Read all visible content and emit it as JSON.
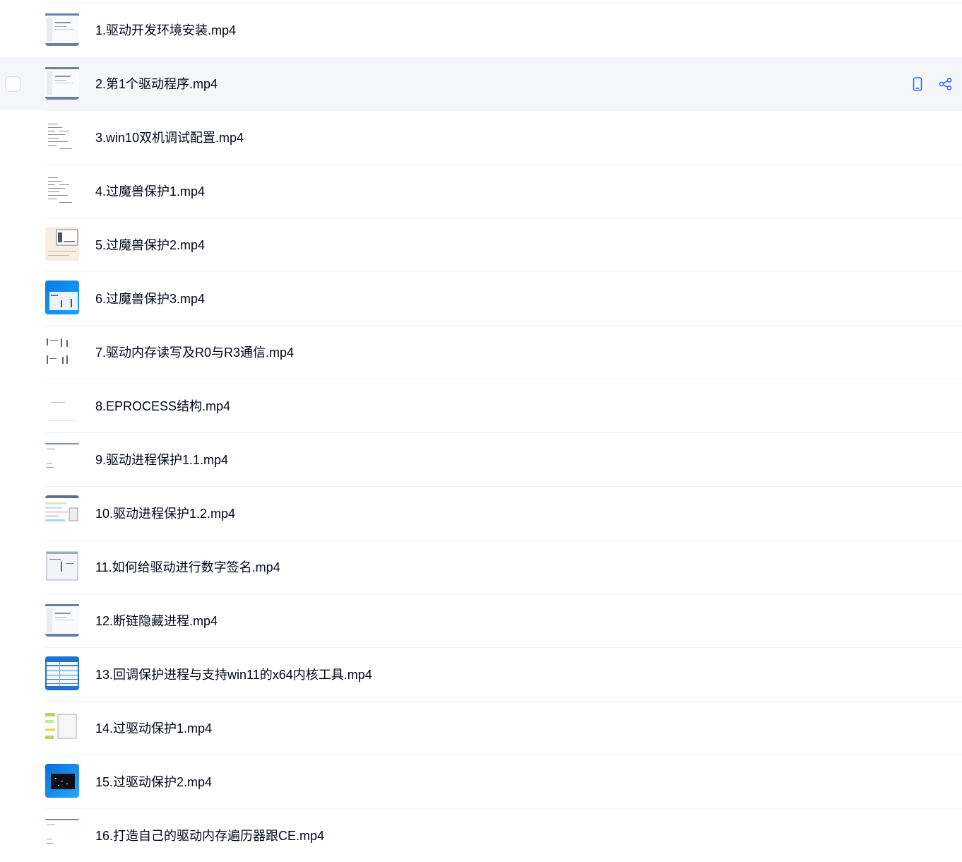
{
  "files": [
    {
      "name": "1.驱动开发环境安装.mp4",
      "thumb": "window-light"
    },
    {
      "name": "2.第1个驱动程序.mp4",
      "thumb": "window-light",
      "hovered": true
    },
    {
      "name": "3.win10双机调试配置.mp4",
      "thumb": "text-doc"
    },
    {
      "name": "4.过魔兽保护1.mp4",
      "thumb": "text-doc"
    },
    {
      "name": "5.过魔兽保护2.mp4",
      "thumb": "beige-dialog"
    },
    {
      "name": "6.过魔兽保护3.mp4",
      "thumb": "blue-desktop"
    },
    {
      "name": "7.驱动内存读写及R0与R3通信.mp4",
      "thumb": "code-columns"
    },
    {
      "name": "8.EPROCESS结构.mp4",
      "thumb": "blank"
    },
    {
      "name": "9.驱动进程保护1.1.mp4",
      "thumb": "window-plain"
    },
    {
      "name": "10.驱动进程保护1.2.mp4",
      "thumb": "colored-editor"
    },
    {
      "name": "11.如何给驱动进行数字签名.mp4",
      "thumb": "dialog-panel"
    },
    {
      "name": "12.断链隐藏进程.mp4",
      "thumb": "window-light"
    },
    {
      "name": "13.回调保护进程与支持win11的x64内核工具.mp4",
      "thumb": "blue-table"
    },
    {
      "name": "14.过驱动保护1.mp4",
      "thumb": "yellow-green"
    },
    {
      "name": "15.过驱动保护2.mp4",
      "thumb": "dark-desktop"
    },
    {
      "name": "16.打造自己的驱动内存遍历器跟CE.mp4",
      "thumb": "window-plain"
    }
  ],
  "hover_actions": [
    {
      "icon": "phone-icon"
    },
    {
      "icon": "share-icon"
    }
  ],
  "colors": {
    "accent": "#2b6ff6",
    "hover_bg": "#f5f6fa",
    "divider": "#f0f1f4",
    "text": "#03081a"
  }
}
